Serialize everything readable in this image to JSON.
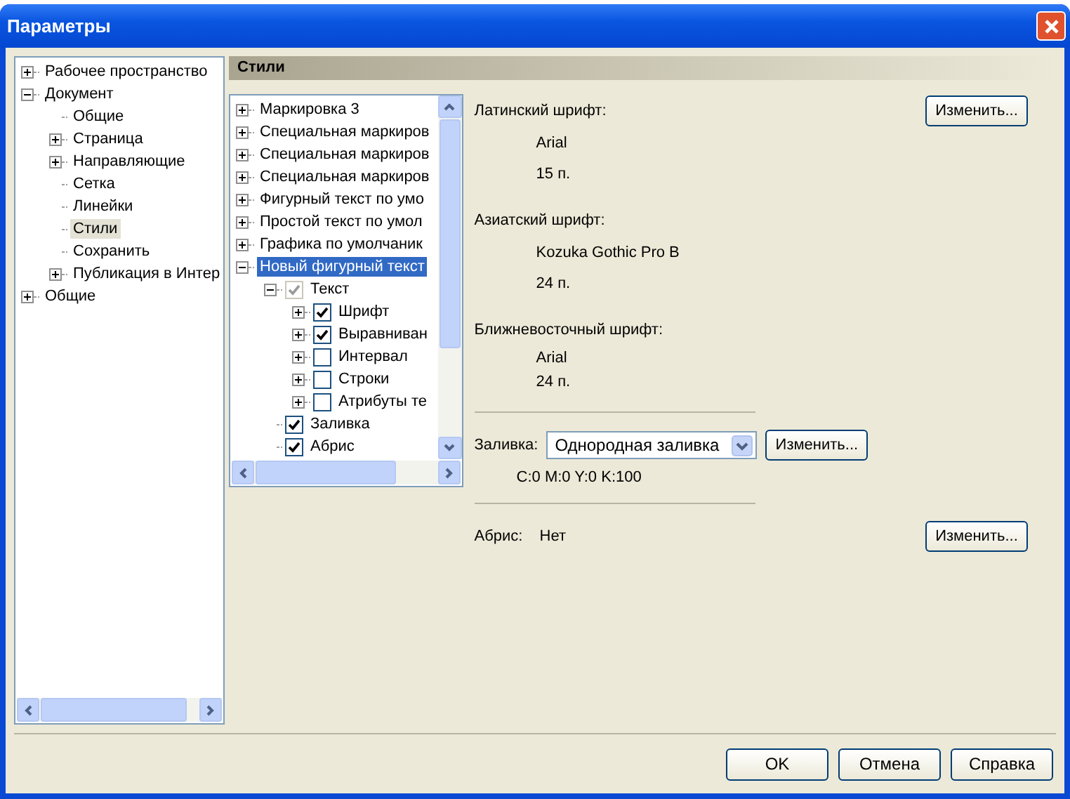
{
  "window": {
    "title": "Параметры"
  },
  "nav_tree": [
    {
      "label": "Рабочее пространство",
      "kind": "folder",
      "expanded": false,
      "selected": false
    },
    {
      "label": "Документ",
      "kind": "folder",
      "expanded": true,
      "selected": false,
      "children": [
        {
          "label": "Общие",
          "kind": "leaf",
          "selected": false
        },
        {
          "label": "Страница",
          "kind": "folder",
          "expanded": false,
          "selected": false
        },
        {
          "label": "Направляющие",
          "kind": "folder",
          "expanded": false,
          "selected": false
        },
        {
          "label": "Сетка",
          "kind": "leaf",
          "selected": false
        },
        {
          "label": "Линейки",
          "kind": "leaf",
          "selected": false
        },
        {
          "label": "Стили",
          "kind": "leaf",
          "selected": true
        },
        {
          "label": "Сохранить",
          "kind": "leaf",
          "selected": false
        },
        {
          "label": "Публикация в Интер",
          "kind": "folder",
          "expanded": false,
          "selected": false
        }
      ]
    },
    {
      "label": "Общие",
      "kind": "folder",
      "expanded": false,
      "selected": false
    }
  ],
  "section_title": "Стили",
  "styles_tree": [
    {
      "label": "Маркировка 3",
      "kind": "folder",
      "expanded": false,
      "selected": false
    },
    {
      "label": "Специальная маркиров",
      "kind": "folder",
      "expanded": false,
      "selected": false
    },
    {
      "label": "Специальная маркиров",
      "kind": "folder",
      "expanded": false,
      "selected": false
    },
    {
      "label": "Специальная маркиров",
      "kind": "folder",
      "expanded": false,
      "selected": false
    },
    {
      "label": "Фигурный текст по умо",
      "kind": "folder",
      "expanded": false,
      "selected": false
    },
    {
      "label": "Простой текст по умол",
      "kind": "folder",
      "expanded": false,
      "selected": false
    },
    {
      "label": "Графика по умолчаник",
      "kind": "folder",
      "expanded": false,
      "selected": false
    },
    {
      "label": "Новый фигурный текст",
      "kind": "folder",
      "expanded": true,
      "selected": true,
      "children": [
        {
          "label": "Текст",
          "kind": "folder",
          "expanded": true,
          "selected": false,
          "checked": true,
          "disabled": true,
          "children": [
            {
              "label": "Шрифт",
              "kind": "folder",
              "expanded": false,
              "selected": false,
              "checked": true,
              "disabled": false
            },
            {
              "label": "Выравниван",
              "kind": "folder",
              "expanded": false,
              "selected": false,
              "checked": true,
              "disabled": false
            },
            {
              "label": "Интервал",
              "kind": "folder",
              "expanded": false,
              "selected": false,
              "checked": false,
              "disabled": false
            },
            {
              "label": "Строки",
              "kind": "folder",
              "expanded": false,
              "selected": false,
              "checked": false,
              "disabled": false
            },
            {
              "label": "Атрибуты те",
              "kind": "folder",
              "expanded": false,
              "selected": false,
              "checked": false,
              "disabled": false
            }
          ]
        },
        {
          "label": "Заливка",
          "kind": "leaf",
          "selected": false,
          "checked": true,
          "disabled": false
        },
        {
          "label": "Абрис",
          "kind": "leaf",
          "selected": false,
          "checked": true,
          "disabled": false
        }
      ]
    }
  ],
  "fonts": [
    {
      "label": "Латинский шрифт:",
      "name": "Arial",
      "size": "15 п.",
      "button": "Изменить..."
    },
    {
      "label": "Азиатский шрифт:",
      "name": "Kozuka Gothic Pro B",
      "size": "24 п."
    },
    {
      "label": "Ближневосточный шрифт:",
      "name": "Arial",
      "size": "24 п."
    }
  ],
  "fill": {
    "label": "Заливка:",
    "value": "Однородная заливка",
    "button": "Изменить...",
    "color_values": "C:0 M:0 Y:0 K:100"
  },
  "outline": {
    "label": "Абрис:",
    "value": "Нет",
    "button": "Изменить..."
  },
  "buttons": [
    "OK",
    "Отмена",
    "Справка"
  ]
}
